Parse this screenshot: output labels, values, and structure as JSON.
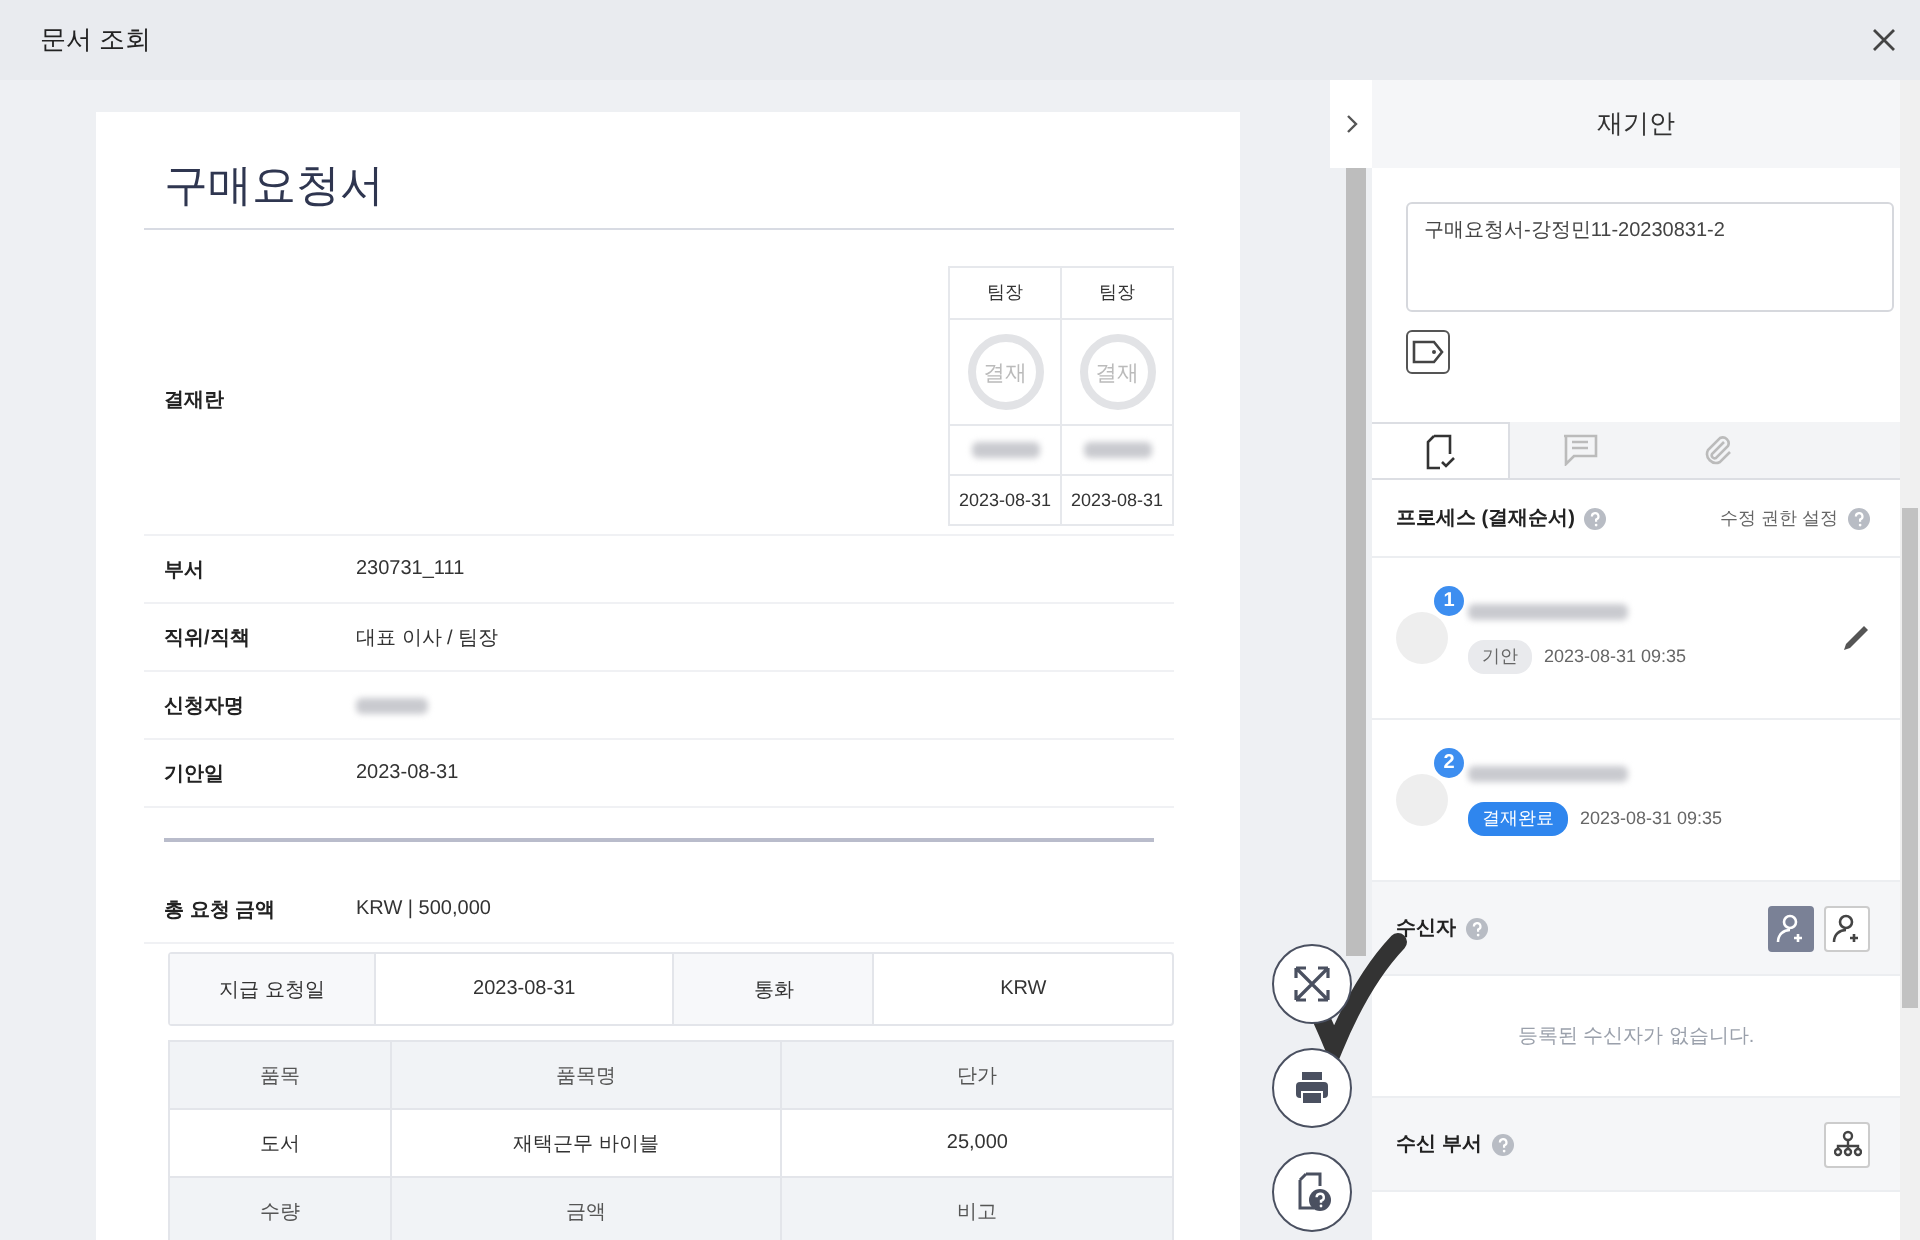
{
  "window": {
    "title": "문서 조회"
  },
  "document": {
    "title": "구매요청서",
    "approval_label": "결재란",
    "approvers": [
      {
        "role": "팀장",
        "stamp": "결재",
        "date": "2023-08-31"
      },
      {
        "role": "팀장",
        "stamp": "결재",
        "date": "2023-08-31"
      }
    ],
    "fields": [
      {
        "label": "부서",
        "value": "230731_111"
      },
      {
        "label": "직위/직책",
        "value": "대표 이사 / 팀장"
      },
      {
        "label": "신청자명",
        "redacted": true
      },
      {
        "label": "기안일",
        "value": "2023-08-31"
      }
    ],
    "total": {
      "label": "총 요청 금액",
      "value": "KRW | 500,000"
    },
    "payment": [
      {
        "kind": "label",
        "text": "지급 요청일"
      },
      {
        "kind": "value",
        "text": "2023-08-31"
      },
      {
        "kind": "label",
        "text": "통화"
      },
      {
        "kind": "value",
        "text": "KRW"
      }
    ],
    "items_table": [
      {
        "header": true,
        "cells": [
          "품목",
          "품목명",
          "단가"
        ]
      },
      {
        "header": false,
        "cells": [
          "도서",
          "재택근무 바이블",
          "25,000"
        ]
      },
      {
        "header": true,
        "cells": [
          "수량",
          "금액",
          "비고"
        ]
      }
    ]
  },
  "panel": {
    "title": "재기안",
    "doc_name": "구매요청서-강정민11-20230831-2",
    "tabs": [
      {
        "kind": "document",
        "selected": true
      },
      {
        "kind": "comment",
        "selected": false
      },
      {
        "kind": "attachment",
        "selected": false
      }
    ],
    "process": {
      "title": "프로세스 (결재순서)",
      "setting": "수정 권한 설정",
      "steps": [
        {
          "number": "1",
          "status": "기안",
          "kind": "draft",
          "time": "2023-08-31 09:35",
          "editable": true
        },
        {
          "number": "2",
          "status": "결재완료",
          "kind": "approved",
          "time": "2023-08-31 09:35",
          "editable": false
        }
      ]
    },
    "recipients": {
      "title": "수신자",
      "empty": "등록된 수신자가 없습니다."
    },
    "departments": {
      "title": "수신 부서"
    }
  }
}
